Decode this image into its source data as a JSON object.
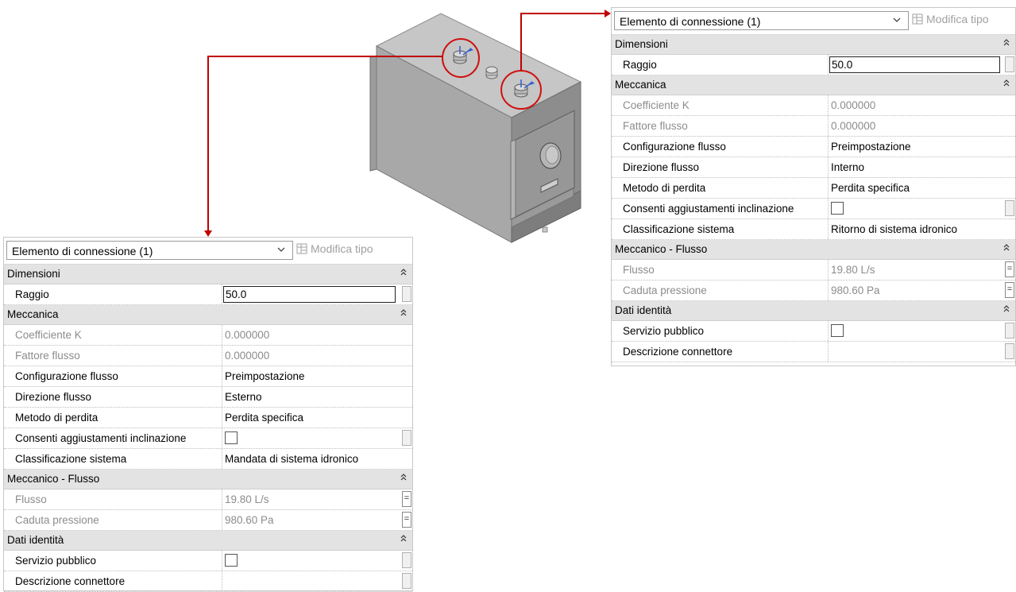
{
  "panels": {
    "left": {
      "type_selector": "Elemento di connessione (1)",
      "edit_type_label": "Modifica tipo",
      "groups": [
        {
          "label": "Dimensioni",
          "rows": [
            {
              "name": "Raggio",
              "value": "50.0",
              "kind": "input",
              "gray": false,
              "side": "scroll"
            }
          ]
        },
        {
          "label": "Meccanica",
          "rows": [
            {
              "name": "Coefficiente K",
              "value": "0.000000",
              "kind": "text",
              "gray": true,
              "side": "none"
            },
            {
              "name": "Fattore flusso",
              "value": "0.000000",
              "kind": "text",
              "gray": true,
              "side": "none"
            },
            {
              "name": "Configurazione flusso",
              "value": "Preimpostazione",
              "kind": "text",
              "gray": false,
              "side": "none"
            },
            {
              "name": "Direzione flusso",
              "value": "Esterno",
              "kind": "text",
              "gray": false,
              "side": "none"
            },
            {
              "name": "Metodo di perdita",
              "value": "Perdita specifica",
              "kind": "text",
              "gray": false,
              "side": "none"
            },
            {
              "name": "Consenti aggiustamenti inclinazione",
              "value": "",
              "kind": "checkbox",
              "gray": false,
              "side": "scroll"
            },
            {
              "name": "Classificazione sistema",
              "value": "Mandata di sistema idronico",
              "kind": "text",
              "gray": false,
              "side": "none"
            }
          ]
        },
        {
          "label": "Meccanico - Flusso",
          "rows": [
            {
              "name": "Flusso",
              "value": "19.80 L/s",
              "kind": "text",
              "gray": true,
              "side": "eq"
            },
            {
              "name": "Caduta pressione",
              "value": "980.60 Pa",
              "kind": "text",
              "gray": true,
              "side": "eq"
            }
          ]
        },
        {
          "label": "Dati identità",
          "rows": [
            {
              "name": "Servizio pubblico",
              "value": "",
              "kind": "checkbox",
              "gray": false,
              "side": "scroll"
            },
            {
              "name": "Descrizione connettore",
              "value": "",
              "kind": "text",
              "gray": false,
              "side": "scroll"
            }
          ]
        }
      ]
    },
    "right": {
      "type_selector": "Elemento di connessione (1)",
      "edit_type_label": "Modifica tipo",
      "groups": [
        {
          "label": "Dimensioni",
          "rows": [
            {
              "name": "Raggio",
              "value": "50.0",
              "kind": "input",
              "gray": false,
              "side": "scroll"
            }
          ]
        },
        {
          "label": "Meccanica",
          "rows": [
            {
              "name": "Coefficiente K",
              "value": "0.000000",
              "kind": "text",
              "gray": true,
              "side": "none"
            },
            {
              "name": "Fattore flusso",
              "value": "0.000000",
              "kind": "text",
              "gray": true,
              "side": "none"
            },
            {
              "name": "Configurazione flusso",
              "value": "Preimpostazione",
              "kind": "text",
              "gray": false,
              "side": "none"
            },
            {
              "name": "Direzione flusso",
              "value": "Interno",
              "kind": "text",
              "gray": false,
              "side": "none"
            },
            {
              "name": "Metodo di perdita",
              "value": "Perdita specifica",
              "kind": "text",
              "gray": false,
              "side": "none"
            },
            {
              "name": "Consenti aggiustamenti inclinazione",
              "value": "",
              "kind": "checkbox",
              "gray": false,
              "side": "scroll"
            },
            {
              "name": "Classificazione sistema",
              "value": "Ritorno di sistema idronico",
              "kind": "text",
              "gray": false,
              "side": "none"
            }
          ]
        },
        {
          "label": "Meccanico - Flusso",
          "rows": [
            {
              "name": "Flusso",
              "value": "19.80 L/s",
              "kind": "text",
              "gray": true,
              "side": "eq"
            },
            {
              "name": "Caduta pressione",
              "value": "980.60 Pa",
              "kind": "text",
              "gray": true,
              "side": "eq"
            }
          ]
        },
        {
          "label": "Dati identità",
          "rows": [
            {
              "name": "Servizio pubblico",
              "value": "",
              "kind": "checkbox",
              "gray": false,
              "side": "scroll"
            },
            {
              "name": "Descrizione connettore",
              "value": "",
              "kind": "text",
              "gray": false,
              "side": "scroll"
            }
          ]
        }
      ]
    }
  },
  "colors": {
    "callout_line": "#c00000",
    "highlight_circle": "#d01010",
    "boiler_front": "#a9a9a9",
    "boiler_top": "#c4c4c4",
    "boiler_side": "#8a8a8a",
    "connector_arrow": "#2f5fd0"
  },
  "icons": [
    "chevron-down-icon",
    "edit-type-icon",
    "collapse-icon",
    "pipe-connector-icon",
    "flow-arrow-icon"
  ]
}
